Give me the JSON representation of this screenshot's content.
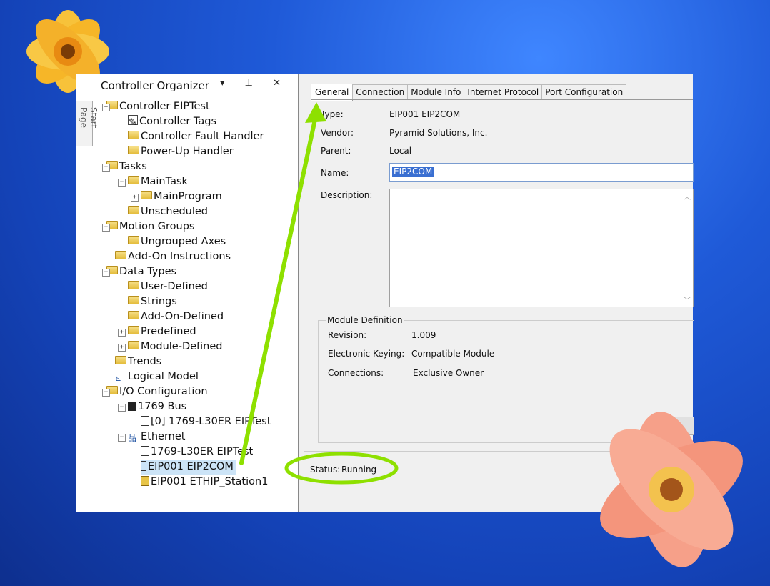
{
  "organizer": {
    "title": "Controller Organizer",
    "controls": "▾ ⊥ ✕",
    "side_tab": "Start Page",
    "tree": [
      {
        "label": "Controller EIPTest"
      },
      {
        "label": "Controller Tags"
      },
      {
        "label": "Controller Fault Handler"
      },
      {
        "label": "Power-Up Handler"
      },
      {
        "label": "Tasks"
      },
      {
        "label": "MainTask"
      },
      {
        "label": "MainProgram"
      },
      {
        "label": "Unscheduled"
      },
      {
        "label": "Motion Groups"
      },
      {
        "label": "Ungrouped Axes"
      },
      {
        "label": "Add-On Instructions"
      },
      {
        "label": "Data Types"
      },
      {
        "label": "User-Defined"
      },
      {
        "label": "Strings"
      },
      {
        "label": "Add-On-Defined"
      },
      {
        "label": "Predefined"
      },
      {
        "label": "Module-Defined"
      },
      {
        "label": "Trends"
      },
      {
        "label": "Logical Model"
      },
      {
        "label": "I/O Configuration"
      },
      {
        "label": "1769 Bus"
      },
      {
        "label": "[0] 1769-L30ER EIPTest"
      },
      {
        "label": "Ethernet"
      },
      {
        "label": "1769-L30ER EIPTest"
      },
      {
        "label": "EIP001 EIP2COM"
      },
      {
        "label": "EIP001 ETHIP_Station1"
      }
    ]
  },
  "props": {
    "tabs": [
      "General",
      "Connection",
      "Module Info",
      "Internet Protocol",
      "Port Configuration"
    ],
    "type_label": "Type:",
    "type_value": "EIP001 EIP2COM",
    "vendor_label": "Vendor:",
    "vendor_value": "Pyramid Solutions, Inc.",
    "parent_label": "Parent:",
    "parent_value": "Local",
    "name_label": "Name:",
    "name_value": "EIP2COM",
    "description_label": "Description:",
    "module_definition": {
      "title": "Module Definition",
      "revision_label": "Revision:",
      "revision_value": "1.009",
      "keying_label": "Electronic Keying:",
      "keying_value": "Compatible Module",
      "connections_label": "Connections:",
      "connections_value": "Exclusive Owner"
    },
    "status_label": "Status:",
    "status_value": "Running"
  },
  "annotation": {
    "arrow_color": "#8ee000",
    "ellipse_color": "#8ee000"
  }
}
